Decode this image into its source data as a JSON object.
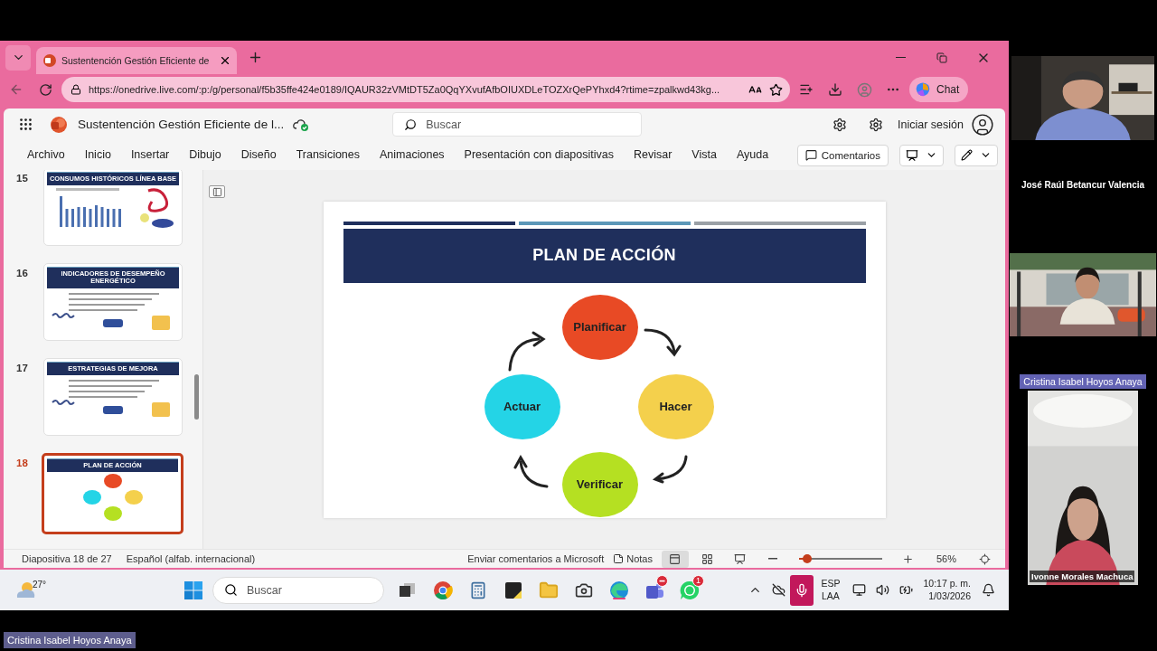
{
  "browser": {
    "tab_title": "Sustentención Gestión Eficiente de",
    "address": "https://onedrive.live.com/:p:/g/personal/f5b35ffe424e0189/IQAUR32zVMtDT5Za0QqYXvufAfbOIUXDLeTOZXrQePYhxd4?rtime=zpalkwd43kg...",
    "chat": "Chat"
  },
  "app": {
    "doc_title": "Sustentención Gestión Eficiente de l...",
    "search_placeholder": "Buscar",
    "sign_in": "Iniciar sesión"
  },
  "ribbon_tabs": [
    {
      "label": "Archivo",
      "selected": false
    },
    {
      "label": "Inicio",
      "selected": false
    },
    {
      "label": "Insertar",
      "selected": false
    },
    {
      "label": "Dibujo",
      "selected": false
    },
    {
      "label": "Diseño",
      "selected": false
    },
    {
      "label": "Transiciones",
      "selected": false
    },
    {
      "label": "Animaciones",
      "selected": false
    },
    {
      "label": "Presentación con diapositivas",
      "selected": false
    },
    {
      "label": "Revisar",
      "selected": false
    },
    {
      "label": "Vista",
      "selected": false
    },
    {
      "label": "Ayuda",
      "selected": false
    }
  ],
  "comments_button": "Comentarios",
  "thumbnails": [
    {
      "number": "15",
      "title": "CONSUMOS HISTÓRICOS LÍNEA BASE",
      "kind": "chart",
      "selected": false
    },
    {
      "number": "16",
      "title": "INDICADORES DE DESEMPEÑO ENERGÉTICO",
      "kind": "bullets",
      "selected": false
    },
    {
      "number": "17",
      "title": "ESTRATEGIAS DE MEJORA",
      "kind": "bullets",
      "selected": false
    },
    {
      "number": "18",
      "title": "PLAN DE ACCIÓN",
      "kind": "cycle",
      "selected": true
    }
  ],
  "slide": {
    "title": "PLAN DE ACCIÓN",
    "steps": [
      {
        "label": "Planificar",
        "color": "#e84a25"
      },
      {
        "label": "Hacer",
        "color": "#f4d04c"
      },
      {
        "label": "Verificar",
        "color": "#b5e022"
      },
      {
        "label": "Actuar",
        "color": "#24d4e6"
      }
    ]
  },
  "status_bar": {
    "slide_info": "Diapositiva 18 de 27",
    "language": "Español (alfab. internacional)",
    "feedback": "Enviar comentarios a Microsoft",
    "notes": "Notas",
    "zoom": {
      "level": 0.1
    },
    "zoom_reading": "56%"
  },
  "taskbar": {
    "temperature": "27°",
    "search_placeholder": "Buscar",
    "input_language": "ESP",
    "input_layout": "LAA",
    "time": "10:17 p. m.",
    "date": "1/03/2026",
    "whatsapp_badge": "1"
  },
  "participants": [
    {
      "name": "José Raúl Betancur Valencia",
      "kind": "caption"
    },
    {
      "name": "Cristina Isabel Hoyos Anaya",
      "kind": "highlight"
    },
    {
      "name": "Ivonne Morales Machuca",
      "kind": "overlay"
    }
  ],
  "presenter_label": "Cristina Isabel Hoyos Anaya"
}
